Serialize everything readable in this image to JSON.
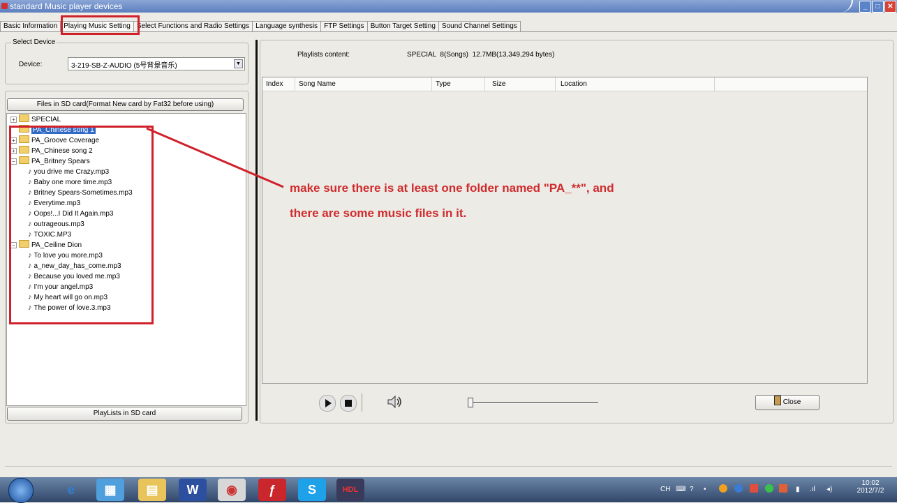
{
  "window": {
    "title": "standard Music player devices",
    "min_glyph": "_",
    "max_glyph": "□",
    "close_glyph": "✕"
  },
  "tabs": [
    {
      "label": "Basic Information"
    },
    {
      "label": "Playing Music Setting",
      "active": true
    },
    {
      "label": "Select Functions and Radio Settings"
    },
    {
      "label": "Language synthesis"
    },
    {
      "label": "FTP Settings"
    },
    {
      "label": "Button Target Setting"
    },
    {
      "label": "Sound Channel Settings"
    }
  ],
  "select_device": {
    "group_label": "Select Device",
    "device_label": "Device:",
    "device_value": "3-219-SB-Z-AUDIO (5号背景音乐)"
  },
  "sd_files_button": "Files in SD card(Format New card by Fat32 before using)",
  "playlists_button": "PlayLists in SD card",
  "tree": [
    {
      "type": "folder",
      "label": "SPECIAL",
      "level": 0,
      "expander": "+"
    },
    {
      "type": "folder",
      "label": "PA_Chinese song 1",
      "level": 0,
      "selected": true
    },
    {
      "type": "folder",
      "label": "PA_Groove Coverage",
      "level": 0,
      "expander": "+"
    },
    {
      "type": "folder",
      "label": "PA_Chinese song 2",
      "level": 0,
      "expander": "+"
    },
    {
      "type": "folder",
      "label": "PA_Britney Spears",
      "level": 0,
      "expander": "−"
    },
    {
      "type": "file",
      "label": "you drive me Crazy.mp3",
      "level": 1
    },
    {
      "type": "file",
      "label": "Baby one more time.mp3",
      "level": 1
    },
    {
      "type": "file",
      "label": "Britney Spears-Sometimes.mp3",
      "level": 1
    },
    {
      "type": "file",
      "label": "Everytime.mp3",
      "level": 1
    },
    {
      "type": "file",
      "label": "Oops!...I Did It Again.mp3",
      "level": 1
    },
    {
      "type": "file",
      "label": "outrageous.mp3",
      "level": 1
    },
    {
      "type": "file",
      "label": "TOXIC.MP3",
      "level": 1
    },
    {
      "type": "folder",
      "label": "PA_Ceiline Dion",
      "level": 0,
      "expander": "−"
    },
    {
      "type": "file",
      "label": "To love you more.mp3",
      "level": 1
    },
    {
      "type": "file",
      "label": "a_new_day_has_come.mp3",
      "level": 1
    },
    {
      "type": "file",
      "label": "Because you loved me.mp3",
      "level": 1
    },
    {
      "type": "file",
      "label": "I'm your angel.mp3",
      "level": 1
    },
    {
      "type": "file",
      "label": "My heart will go on.mp3",
      "level": 1
    },
    {
      "type": "file",
      "label": "The power of love.3.mp3",
      "level": 1
    }
  ],
  "playlist_info": {
    "label": "Playlists content:",
    "value": "SPECIAL  8(Songs)  12.7MB(13,349,294 bytes)"
  },
  "columns": [
    "Index",
    "Song Name",
    "Type",
    "Size",
    "Location"
  ],
  "annotation": {
    "line1": "make sure there is at least one folder named \"PA_**\", and",
    "line2": "there are some music files in it."
  },
  "player": {
    "play_icon": "play-icon",
    "stop_icon": "stop-icon",
    "volume_icon": "speaker-icon",
    "progress": 0.0,
    "close_label": "Close"
  },
  "taskbar": {
    "apps": [
      "IE",
      "Control Panel",
      "Explorer",
      "Word",
      "QQ",
      "Flash",
      "Skype",
      "HDL"
    ],
    "tray_lang": "CH",
    "time": "10:02",
    "date": "2012/7/2"
  },
  "colors": {
    "highlight": "#d0202a",
    "selection": "#3169c6"
  }
}
